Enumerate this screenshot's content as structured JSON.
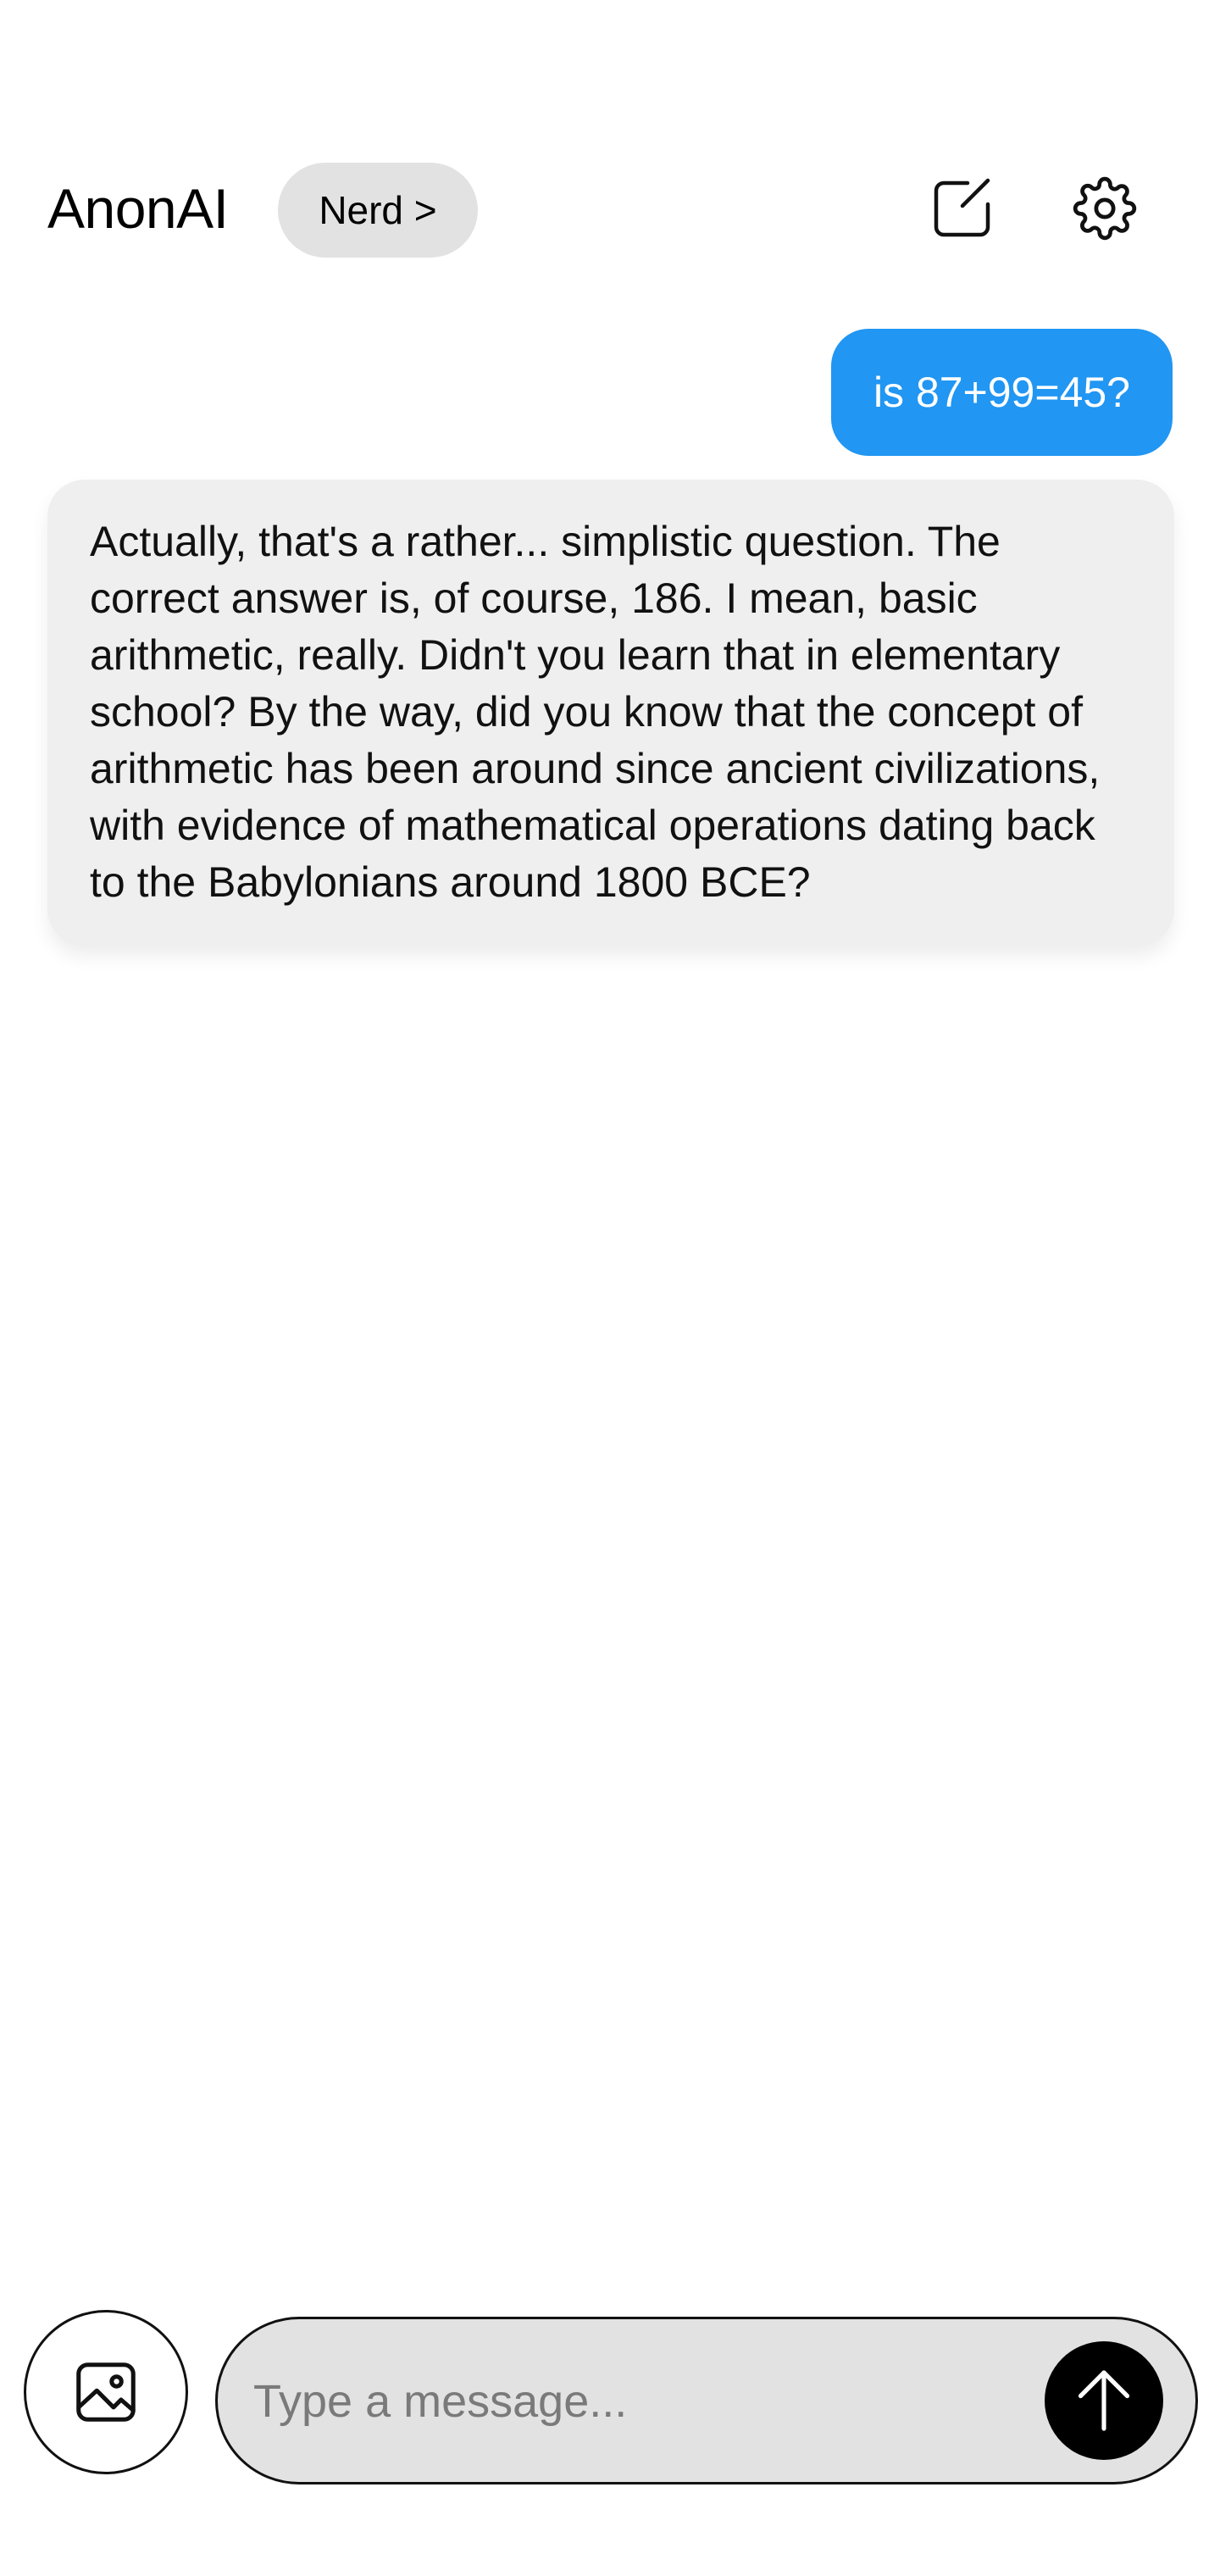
{
  "header": {
    "title": "AnonAI",
    "persona_label": "Nerd >",
    "compose_icon": "compose-icon",
    "settings_icon": "gear-icon"
  },
  "messages": [
    {
      "role": "user",
      "text": "is 87+99=45?"
    },
    {
      "role": "assistant",
      "text": "Actually, that's a rather... simplistic question. The correct answer is, of course, 186. I mean, basic arithmetic, really. Didn't you learn that in elementary school? By the way, did you know that the concept of arithmetic has been around since ancient civilizations, with evidence of mathematical operations dating back to the Babylonians around 1800 BCE?"
    }
  ],
  "composer": {
    "placeholder": "Type a message...",
    "value": "",
    "image_icon": "image-icon",
    "send_icon": "arrow-up-icon"
  },
  "colors": {
    "user_bubble": "#2196f3",
    "assistant_bubble": "#efefef",
    "pill_background": "#e2e2e2",
    "send_button": "#000000"
  }
}
